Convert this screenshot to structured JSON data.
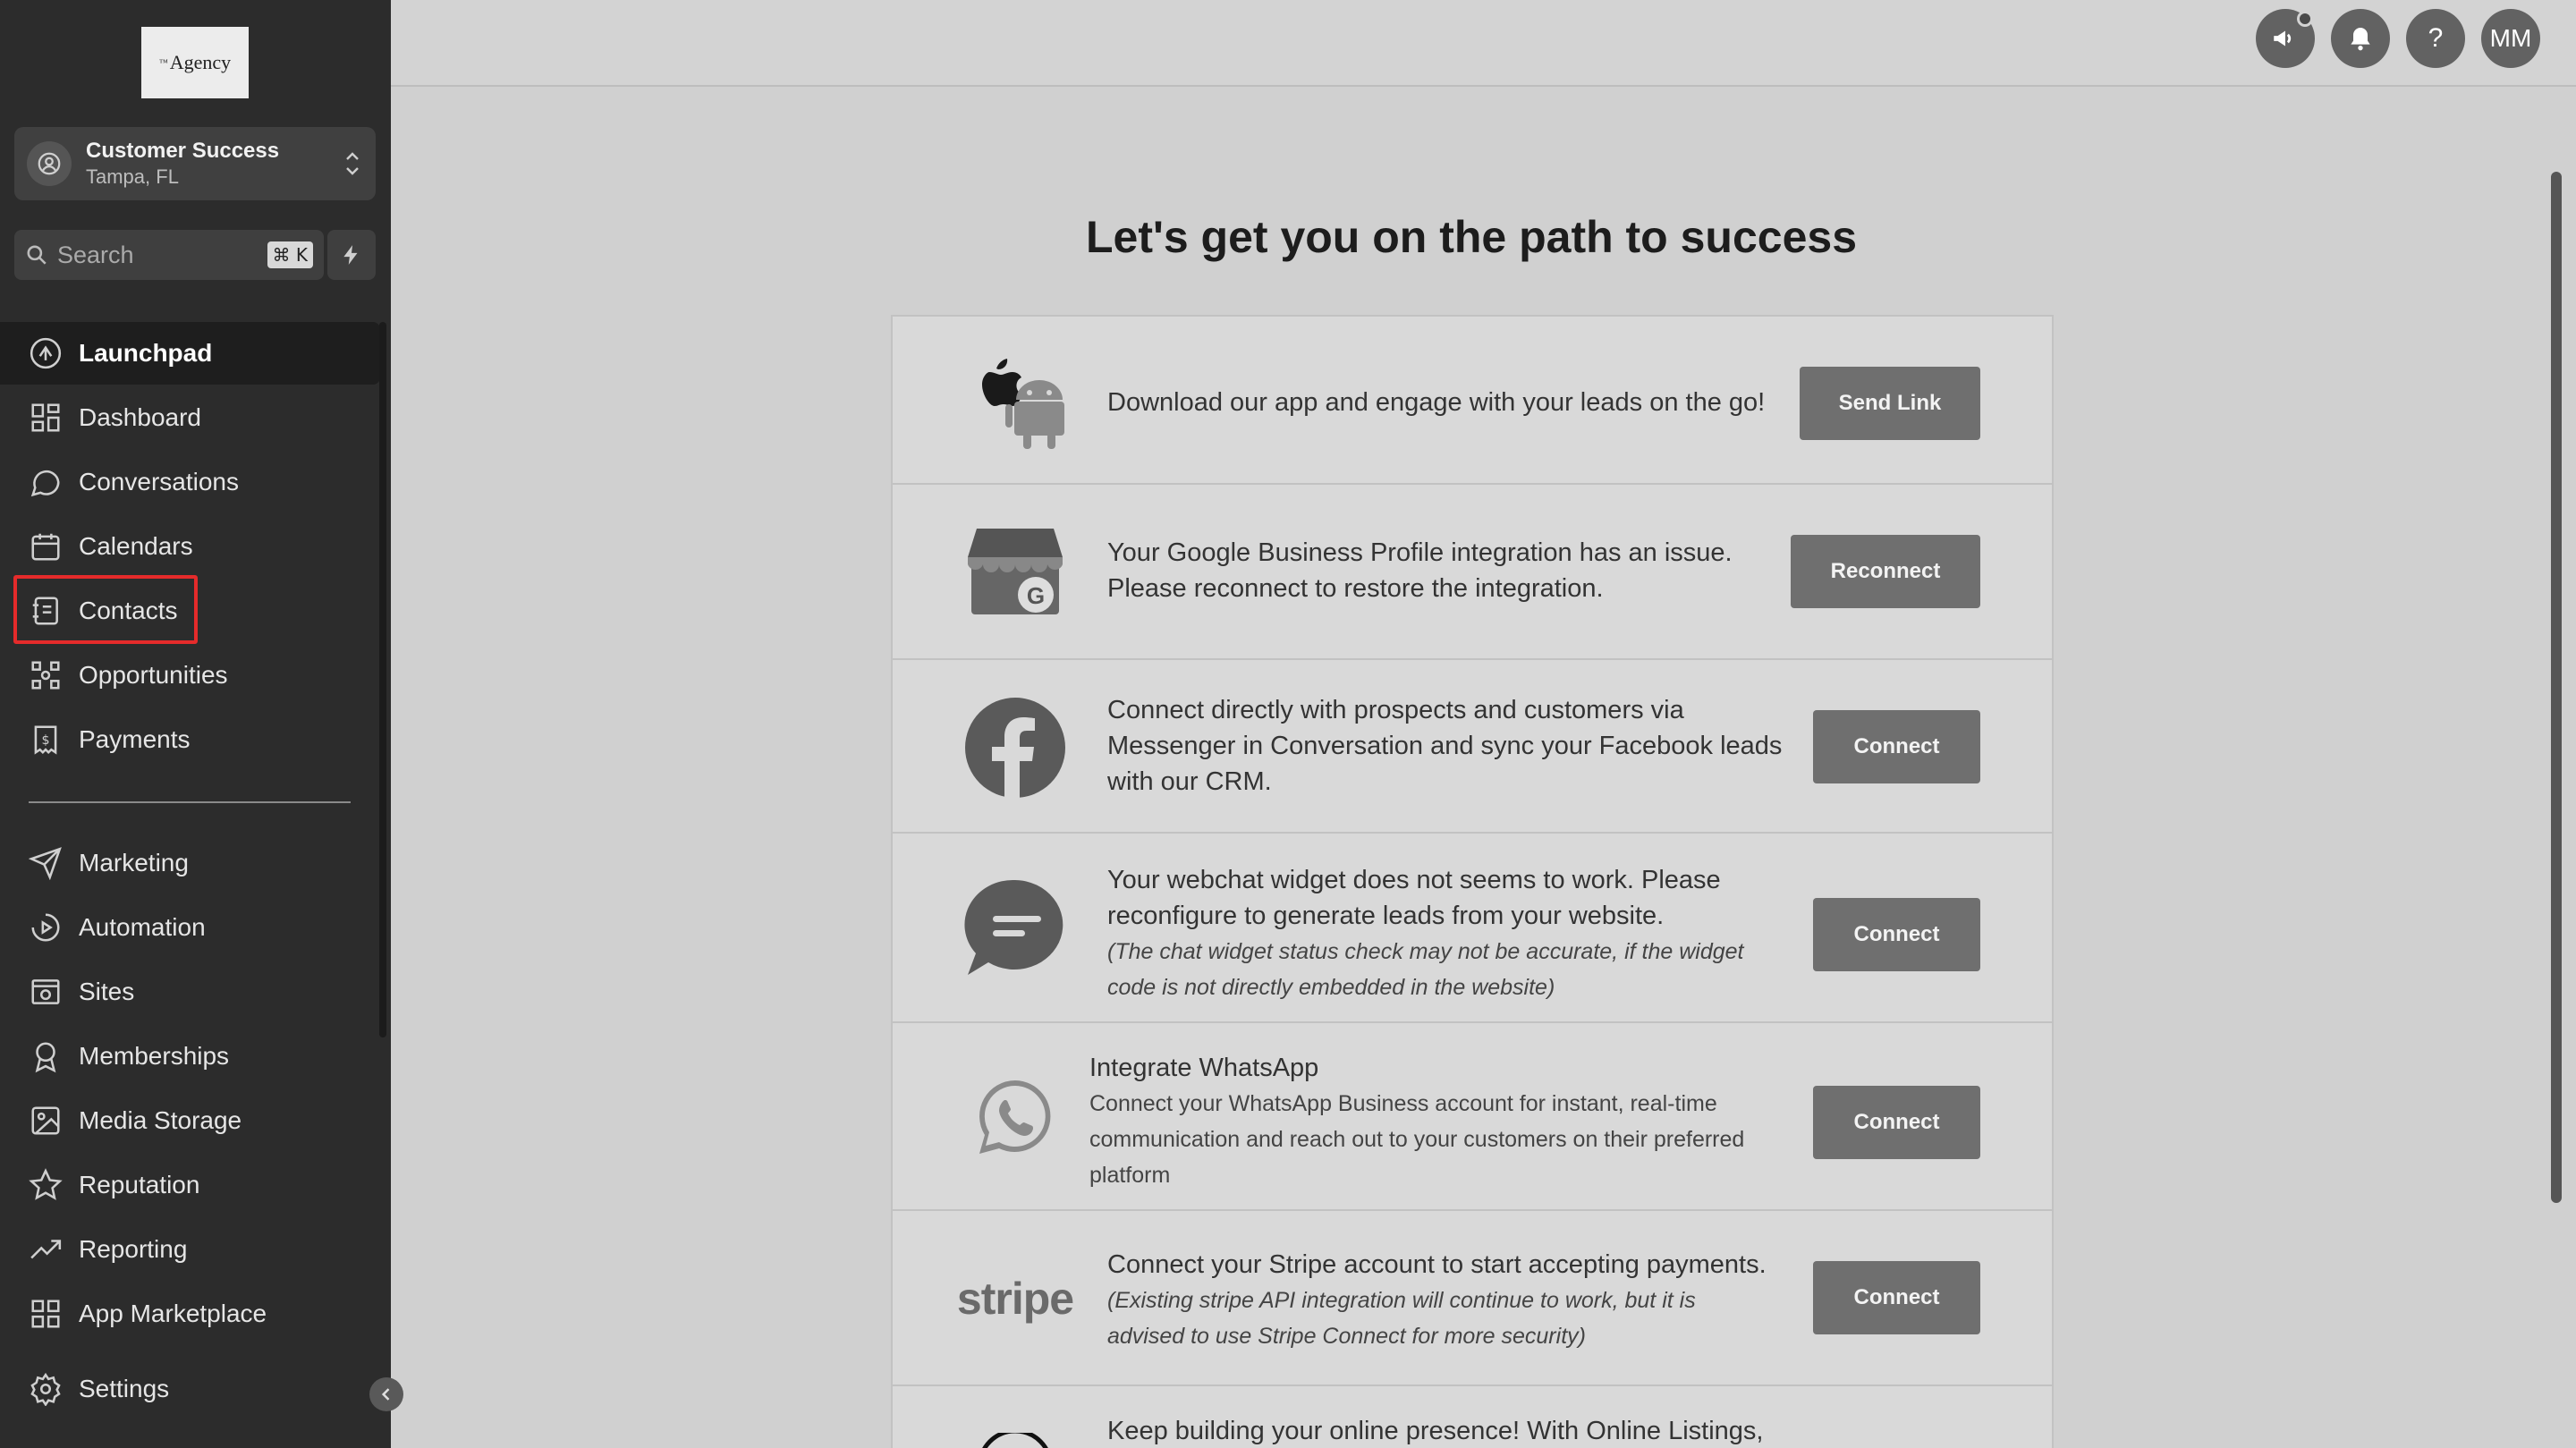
{
  "logo": {
    "text": "Agency",
    "sup": "™"
  },
  "account": {
    "name": "Customer Success",
    "location": "Tampa, FL"
  },
  "search": {
    "placeholder": "Search",
    "shortcut": "⌘ K"
  },
  "nav": {
    "items": [
      {
        "label": "Launchpad",
        "icon": "rocket-icon"
      },
      {
        "label": "Dashboard",
        "icon": "dashboard-icon"
      },
      {
        "label": "Conversations",
        "icon": "chat-icon"
      },
      {
        "label": "Calendars",
        "icon": "calendar-icon"
      },
      {
        "label": "Contacts",
        "icon": "contacts-icon"
      },
      {
        "label": "Opportunities",
        "icon": "opportunities-icon"
      },
      {
        "label": "Payments",
        "icon": "payments-icon"
      },
      {
        "label": "Marketing",
        "icon": "send-icon"
      },
      {
        "label": "Automation",
        "icon": "automation-icon"
      },
      {
        "label": "Sites",
        "icon": "sites-icon"
      },
      {
        "label": "Memberships",
        "icon": "membership-icon"
      },
      {
        "label": "Media Storage",
        "icon": "image-icon"
      },
      {
        "label": "Reputation",
        "icon": "star-icon"
      },
      {
        "label": "Reporting",
        "icon": "trend-icon"
      },
      {
        "label": "App Marketplace",
        "icon": "apps-icon"
      },
      {
        "label": "Settings",
        "icon": "gear-icon"
      }
    ],
    "active": "Launchpad",
    "highlighted": "Contacts"
  },
  "topbar": {
    "avatar_initials": "MM",
    "help": "?"
  },
  "main": {
    "headline": "Let's get you on the path to success",
    "cards": [
      {
        "text": "Download our app and engage with your leads on the go!",
        "button": "Send Link"
      },
      {
        "line1": "Your Google Business Profile integration has an issue.",
        "line2": "Please reconnect to restore the integration.",
        "button": "Reconnect"
      },
      {
        "line1": "Connect directly with prospects and customers via",
        "line2": "Messenger in Conversation and sync your Facebook leads",
        "line3": "with our CRM.",
        "button": "Connect"
      },
      {
        "line1": "Your webchat widget does not seems to work. Please",
        "line2": "reconfigure to generate leads from your website.",
        "note1": "(The chat widget status check may not be accurate, if the widget",
        "note2": "code is not directly embedded in the website)",
        "button": "Connect"
      },
      {
        "title": "Integrate WhatsApp",
        "body1": "Connect your WhatsApp Business account for instant, real-time",
        "body2": "communication and reach out to your customers on their preferred",
        "body3": "platform",
        "button": "Connect"
      },
      {
        "logo_text": "stripe",
        "line1": "Connect your Stripe account to start accepting payments.",
        "note1": "(Existing stripe API integration will continue to work, but it is",
        "note2": "advised to use Stripe Connect for more security)",
        "button": "Connect"
      },
      {
        "line1": "Keep building your online presence! With Online Listings,"
      }
    ]
  },
  "colors": {
    "sidebar": "#2c2c2c",
    "highlight": "#e52b2b",
    "button": "#6f6f6f"
  }
}
